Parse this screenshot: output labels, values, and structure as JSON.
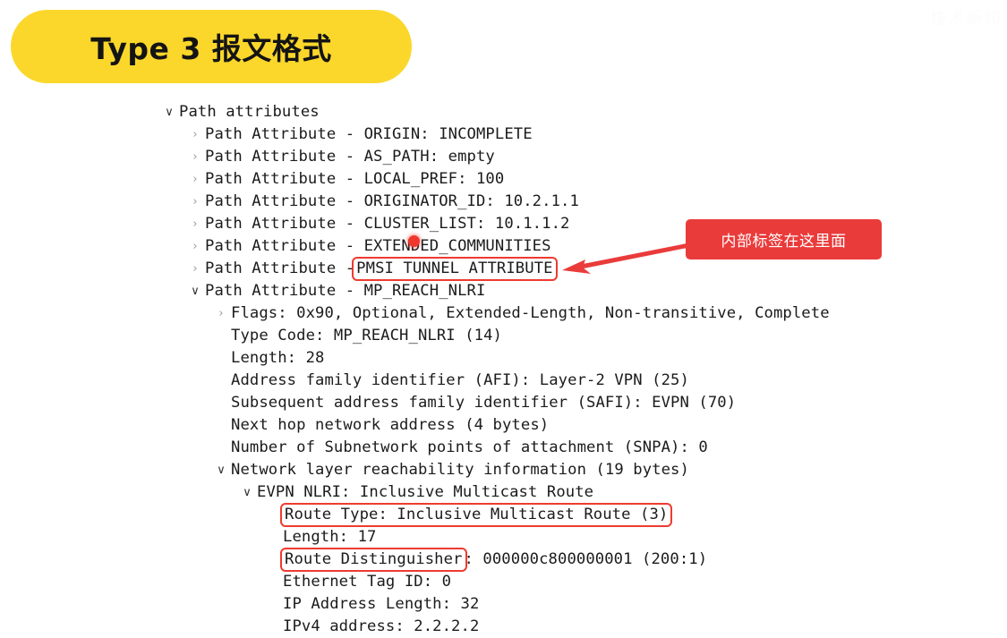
{
  "watermark": {
    "text": "技术新知"
  },
  "badge": {
    "title": "Type 3 报文格式"
  },
  "annotation": {
    "text": "内部标签在这里面",
    "box_color": "#ea3b3b",
    "arrow_color": "#ea3b3b"
  },
  "colors": {
    "badge_yellow": "#FBD72B",
    "highlight_cyan": "#d9f7fd",
    "box_outline_red": "#ee3b30",
    "cursor_red": "#f0372e",
    "text": "#1b1b1b"
  },
  "tree": {
    "rows": [
      {
        "indent": 0,
        "chevron": "open",
        "text": "Path attributes"
      },
      {
        "indent": 1,
        "chevron": "closed",
        "text": "Path Attribute - ORIGIN: INCOMPLETE"
      },
      {
        "indent": 1,
        "chevron": "closed",
        "text": "Path Attribute - AS_PATH: empty"
      },
      {
        "indent": 1,
        "chevron": "closed",
        "text": "Path Attribute - LOCAL_PREF: 100"
      },
      {
        "indent": 1,
        "chevron": "closed",
        "text": "Path Attribute - ORIGINATOR_ID: 10.2.1.1"
      },
      {
        "indent": 1,
        "chevron": "closed",
        "text": "Path Attribute - CLUSTER_LIST: 10.1.1.2"
      },
      {
        "indent": 1,
        "chevron": "closed",
        "text": "Path Attribute - EXTENDED_COMMUNITIES"
      },
      {
        "indent": 1,
        "chevron": "closed",
        "prefix": "Path Attribute - ",
        "boxed": "PMSI TUNNEL ATTRIBUTE",
        "suffix": ""
      },
      {
        "indent": 1,
        "chevron": "open",
        "text": "Path Attribute - MP_REACH_NLRI"
      },
      {
        "indent": 2,
        "chevron": "closed",
        "text": "Flags: 0x90, Optional, Extended-Length, Non-transitive, Complete"
      },
      {
        "indent": 2,
        "chevron": "blank",
        "text": "Type Code: MP_REACH_NLRI (14)"
      },
      {
        "indent": 2,
        "chevron": "blank",
        "text": "Length: 28"
      },
      {
        "indent": 2,
        "chevron": "blank",
        "text": "Address family identifier (AFI): Layer-2 VPN (25)"
      },
      {
        "indent": 2,
        "chevron": "blank",
        "text": "Subsequent address family identifier (SAFI): EVPN (70)"
      },
      {
        "indent": 2,
        "chevron": "blank",
        "text": "Next hop network address (4 bytes)"
      },
      {
        "indent": 2,
        "chevron": "blank",
        "text": "Number of Subnetwork points of attachment (SNPA): 0"
      },
      {
        "indent": 2,
        "chevron": "open",
        "text": "Network layer reachability information (19 bytes)"
      },
      {
        "indent": 3,
        "chevron": "open",
        "text": "EVPN NLRI: Inclusive Multicast Route",
        "highlight": true
      },
      {
        "indent": 4,
        "chevron": "blank",
        "prefix": "",
        "boxed": "Route Type: Inclusive Multicast Route (3)",
        "suffix": ""
      },
      {
        "indent": 4,
        "chevron": "blank",
        "text": "Length: 17"
      },
      {
        "indent": 4,
        "chevron": "blank",
        "prefix": "",
        "boxed": "Route Distinguisher",
        "suffix": ": 000000c800000001 (200:1)"
      },
      {
        "indent": 4,
        "chevron": "blank",
        "text": "Ethernet Tag ID: 0"
      },
      {
        "indent": 4,
        "chevron": "blank",
        "text": "IP Address Length: 32"
      },
      {
        "indent": 4,
        "chevron": "blank",
        "text": "IPv4 address: 2.2.2.2"
      }
    ],
    "glyphs": {
      "closed": "›",
      "open": "∨",
      "blank": "·"
    }
  }
}
